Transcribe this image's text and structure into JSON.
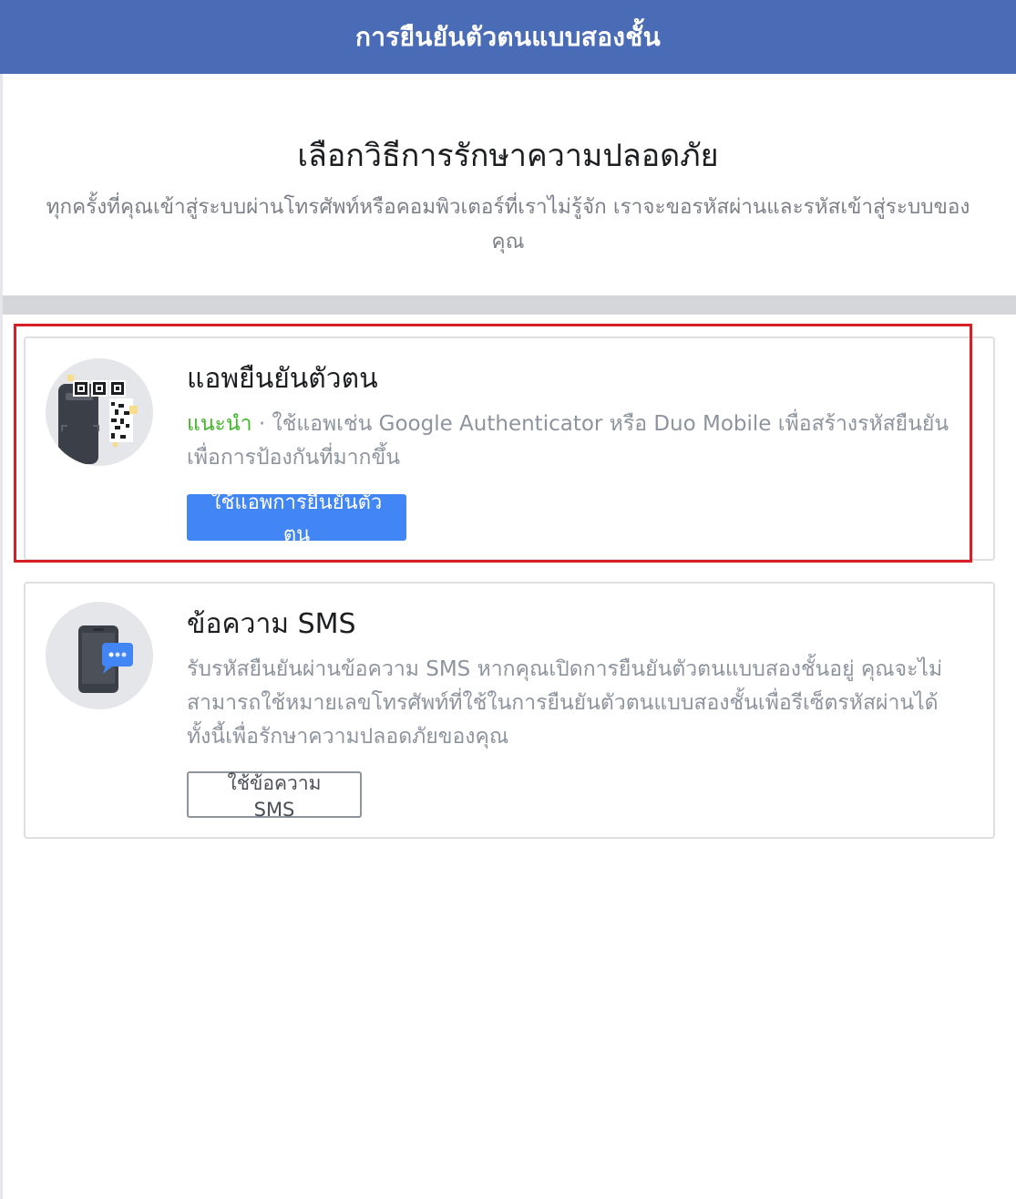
{
  "header": {
    "title": "การยืนยันตัวตนแบบสองชั้น"
  },
  "intro": {
    "title": "เลือกวิธีการรักษาความปลอดภัย",
    "description": "ทุกครั้งที่คุณเข้าสู่ระบบผ่านโทรศัพท์หรือคอมพิวเตอร์ที่เราไม่รู้จัก เราจะขอรหัสผ่านและรหัสเข้าสู่ระบบของคุณ"
  },
  "options": {
    "auth_app": {
      "icon": "qr-phone-icon",
      "title": "แอพยืนยันตัวตน",
      "recommended": "แนะนำ",
      "separator": " · ",
      "description": "ใช้แอพเช่น Google Authenticator หรือ Duo Mobile เพื่อสร้างรหัสยืนยันเพื่อการป้องกันที่มากขึ้น",
      "button": "ใช้แอพการยืนยันตัวตน"
    },
    "sms": {
      "icon": "sms-phone-icon",
      "title": "ข้อความ SMS",
      "description": "รับรหัสยืนยันผ่านข้อความ SMS หากคุณเปิดการยืนยันตัวตนแบบสองชั้นอยู่ คุณจะไม่สามารถใช้หมายเลขโทรศัพท์ที่ใช้ในการยืนยันตัวตนแบบสองชั้นเพื่อรีเซ็ตรหัสผ่านได้ ทั้งนี้เพื่อรักษาความปลอดภัยของคุณ",
      "button": "ใช้ข้อความ SMS"
    }
  },
  "colors": {
    "header_bg": "#4a6bb5",
    "primary_button": "#4285f4",
    "recommended": "#42b72a",
    "highlight_border": "#d91f26"
  }
}
